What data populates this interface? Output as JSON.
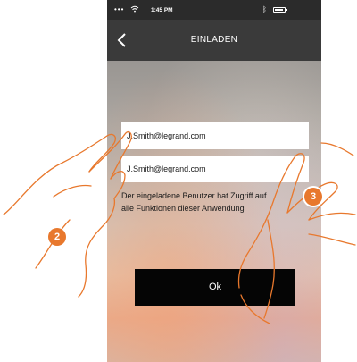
{
  "status_bar": {
    "time": "1:45 PM"
  },
  "nav": {
    "title": "EINLADEN"
  },
  "form": {
    "email_1": "J.Smith@legrand.com",
    "email_2": "J.Smith@legrand.com",
    "info_line_1": "Der eingeladene Benutzer hat Zugriff auf",
    "info_line_2": "alle Funktionen dieser Anwendung",
    "ok_label": "Ok"
  },
  "steps": {
    "step_2": "2",
    "step_3": "3"
  },
  "colors": {
    "navbar": "#3a3a3a",
    "statusbar": "#2b2b2b",
    "badge": "#e8782d",
    "button": "#050505"
  }
}
